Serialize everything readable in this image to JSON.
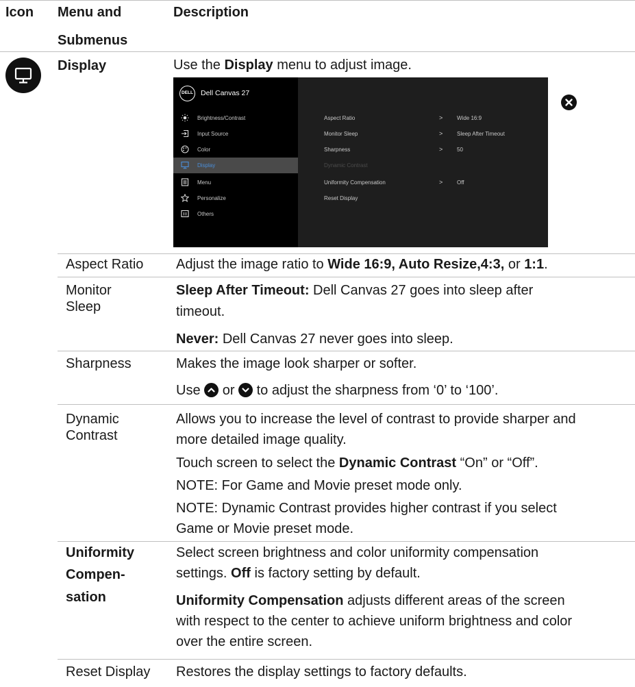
{
  "headers": {
    "icon": "Icon",
    "menu_line1": "Menu and",
    "menu_line2": "Submenus",
    "description": "Description"
  },
  "display_section": {
    "icon": "monitor-icon",
    "name": "Display",
    "intro_pre": "Use the ",
    "intro_bold": "Display",
    "intro_post": " menu to adjust image."
  },
  "osd": {
    "logo": "DELL",
    "title": "Dell Canvas 27",
    "menu_items": [
      {
        "label": "Brightness/Contrast",
        "icon": "sun-icon",
        "selected": false
      },
      {
        "label": "Input Source",
        "icon": "input-arrow-icon",
        "selected": false
      },
      {
        "label": "Color",
        "icon": "palette-icon",
        "selected": false
      },
      {
        "label": "Display",
        "icon": "monitor-icon",
        "selected": true
      },
      {
        "label": "Menu",
        "icon": "menu-list-icon",
        "selected": false
      },
      {
        "label": "Personalize",
        "icon": "star-icon",
        "selected": false
      },
      {
        "label": "Others",
        "icon": "info-box-icon",
        "selected": false
      }
    ],
    "settings": [
      {
        "label": "Aspect Ratio",
        "chevron": ">",
        "value": "Wide 16:9",
        "disabled": false
      },
      {
        "label": "Monitor Sleep",
        "chevron": ">",
        "value": "Sleep After Timeout",
        "disabled": false
      },
      {
        "label": "Sharpness",
        "chevron": ">",
        "value": "50",
        "disabled": false
      },
      {
        "label": "Dynamic Contrast",
        "chevron": "",
        "value": "",
        "disabled": true
      },
      {
        "label": "Uniformity Compensation",
        "chevron": ">",
        "value": "Off",
        "disabled": false
      },
      {
        "label": "Reset Display",
        "chevron": "",
        "value": "",
        "disabled": false
      }
    ],
    "close_icon": "close-x-icon"
  },
  "rows": {
    "aspect_ratio": {
      "name": "Aspect Ratio",
      "pre": "Adjust the image ratio to ",
      "bold": "Wide 16:9, Auto Resize,4:3,",
      "mid": " or ",
      "bold2": "1:1",
      "post": "."
    },
    "monitor_sleep": {
      "name1": "Monitor",
      "name2": "Sleep",
      "p1_bold": "Sleep After Timeout:",
      "p1_line1": " Dell Canvas 27 goes into sleep after",
      "p1_line2": "timeout.",
      "p2_bold": "Never:",
      "p2_text": " Dell Canvas 27 never goes into sleep."
    },
    "sharpness": {
      "name": "Sharpness",
      "line1": "Makes the image look sharper or softer.",
      "use": "Use",
      "or": "or",
      "line2_post": "to adjust the sharpness from ‘0’ to ‘100’.",
      "up_icon": "chevron-up-circle-icon",
      "down_icon": "chevron-down-circle-icon"
    },
    "dynamic_contrast": {
      "name1": "Dynamic",
      "name2": "Contrast",
      "line1": "Allows you to increase the level of contrast to provide sharper and",
      "line2": "more detailed image quality.",
      "line3_pre": "Touch screen to select the ",
      "line3_bold": "Dynamic Contrast",
      "line3_post": " “On” or “Off”.",
      "note1": "NOTE: For Game and Movie preset mode only.",
      "note2_line1": "NOTE: Dynamic Contrast provides higher contrast if you select",
      "note2_line2": "Game or Movie preset mode."
    },
    "uniformity": {
      "name1": "Uniformity",
      "name2": "Compen-",
      "name3": "sation",
      "p1_line1": "Select screen brightness and color uniformity compensation",
      "p1_line2_pre": "settings. ",
      "p1_bold": "Off",
      "p1_line2_post": " is factory setting by default.",
      "p2_bold": "Uniformity Compensation",
      "p2_line1": " adjusts different areas of the screen",
      "p2_line2": "with respect to the center to achieve uniform brightness and color",
      "p2_line3": "over the entire screen."
    },
    "reset_display": {
      "name": "Reset Display",
      "text": "Restores the display settings to factory defaults."
    }
  }
}
